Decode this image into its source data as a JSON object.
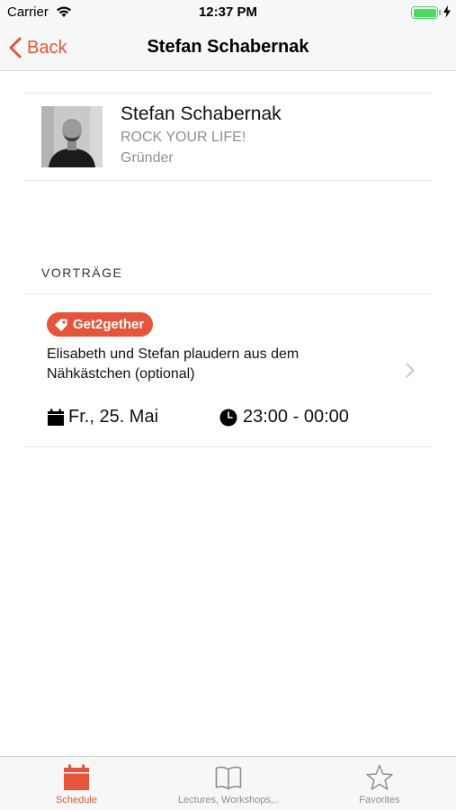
{
  "status_bar": {
    "carrier": "Carrier",
    "time": "12:37 PM"
  },
  "nav": {
    "back_label": "Back",
    "title": "Stefan Schabernak"
  },
  "speaker": {
    "name": "Stefan Schabernak",
    "organization": "ROCK YOUR LIFE!",
    "role": "Gründer"
  },
  "section": {
    "header": "VORTRÄGE"
  },
  "talks": [
    {
      "tag": "Get2gether",
      "title": "Elisabeth und Stefan plaudern aus dem Nähkästchen (optional)",
      "date": "Fr., 25. Mai",
      "time": "23:00 - 00:00"
    }
  ],
  "tab_bar": {
    "items": [
      {
        "label": "Schedule",
        "icon": "calendar-icon",
        "selected": true
      },
      {
        "label": "Lectures, Workshops,..",
        "icon": "book-icon",
        "selected": false
      },
      {
        "label": "Favorites",
        "icon": "star-icon",
        "selected": false
      }
    ]
  },
  "colors": {
    "accent": "#e4553b",
    "inactive": "#8e8e93",
    "battery": "#4cd964"
  }
}
